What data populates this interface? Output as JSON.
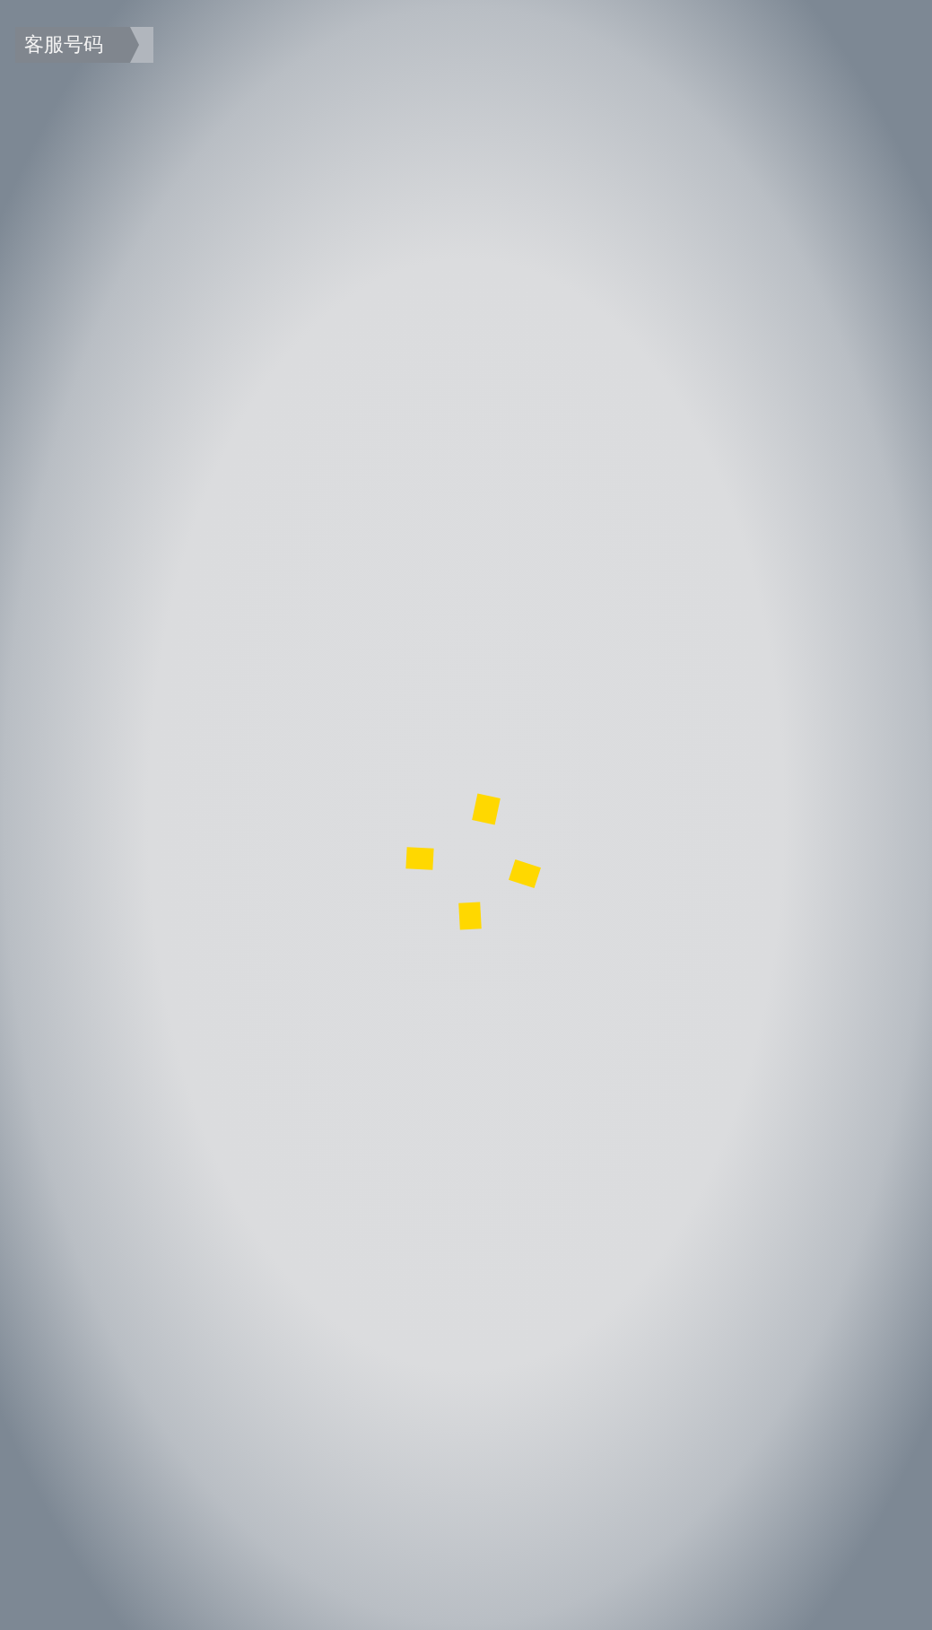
{
  "service_badge": {
    "label": "客服号码"
  }
}
